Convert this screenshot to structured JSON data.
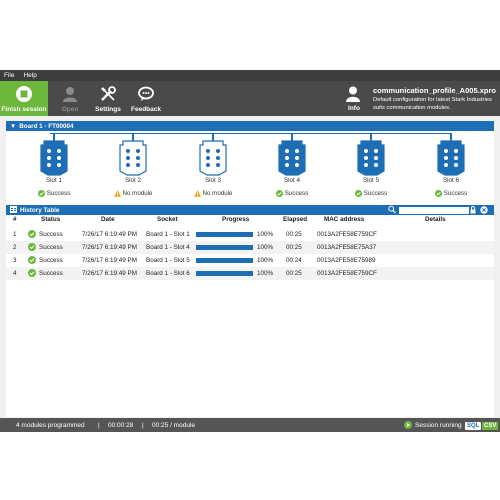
{
  "menu": {
    "file": "File",
    "help": "Help"
  },
  "toolbar": {
    "finish": "Finish session",
    "open": "Open",
    "settings": "Settings",
    "feedback": "Feedback",
    "info": "Info",
    "profile_name": "communication_profile_A005.xpro",
    "profile_desc": "Default configuration for latest Stark Industries suits communication modules."
  },
  "board": {
    "title": "Board 1 - FT00004",
    "slots": [
      {
        "label": "Slot 1",
        "status": "Success",
        "state": "success"
      },
      {
        "label": "Slot 2",
        "status": "No module",
        "state": "empty"
      },
      {
        "label": "Slot 3",
        "status": "No module",
        "state": "empty"
      },
      {
        "label": "Slot 4",
        "status": "Success",
        "state": "success"
      },
      {
        "label": "Slot 5",
        "status": "Success",
        "state": "success"
      },
      {
        "label": "Slot 6",
        "status": "Success",
        "state": "success"
      }
    ]
  },
  "history": {
    "title": "History Table",
    "search_placeholder": "",
    "columns": {
      "num": "#",
      "status": "Status",
      "date": "Date",
      "socket": "Socket",
      "progress": "Progress",
      "elapsed": "Elapsed",
      "mac": "MAC address",
      "details": "Details"
    },
    "rows": [
      {
        "num": "1",
        "status": "Success",
        "date": "7/26/17 6:19:49 PM",
        "socket": "Board 1 - Slot 1",
        "progress": 1.0,
        "progress_label": "100%",
        "elapsed": "00:25",
        "mac": "0013A2FE58E759CF",
        "details": ""
      },
      {
        "num": "2",
        "status": "Success",
        "date": "7/26/17 6:19:49 PM",
        "socket": "Board 1 - Slot 4",
        "progress": 1.0,
        "progress_label": "100%",
        "elapsed": "00:25",
        "mac": "0013A2FE58E75A37",
        "details": ""
      },
      {
        "num": "3",
        "status": "Success",
        "date": "7/26/17 6:19:49 PM",
        "socket": "Board 1 - Slot 5",
        "progress": 1.0,
        "progress_label": "100%",
        "elapsed": "00:24",
        "mac": "0013A2FE58E75989",
        "details": ""
      },
      {
        "num": "4",
        "status": "Success",
        "date": "7/26/17 6:19:49 PM",
        "socket": "Board 1 - Slot 6",
        "progress": 1.0,
        "progress_label": "100%",
        "elapsed": "00:25",
        "mac": "0013A2FE58E759CF",
        "details": ""
      }
    ]
  },
  "status": {
    "modules": "4 modules programmed",
    "time": "00:00:28",
    "rate": "00:25 / module",
    "session": "Session running",
    "sql": "SQL",
    "csv": "CSV"
  },
  "colors": {
    "accent": "#1e6eb5",
    "success": "#6db73c",
    "warning": "#e8a21a"
  }
}
